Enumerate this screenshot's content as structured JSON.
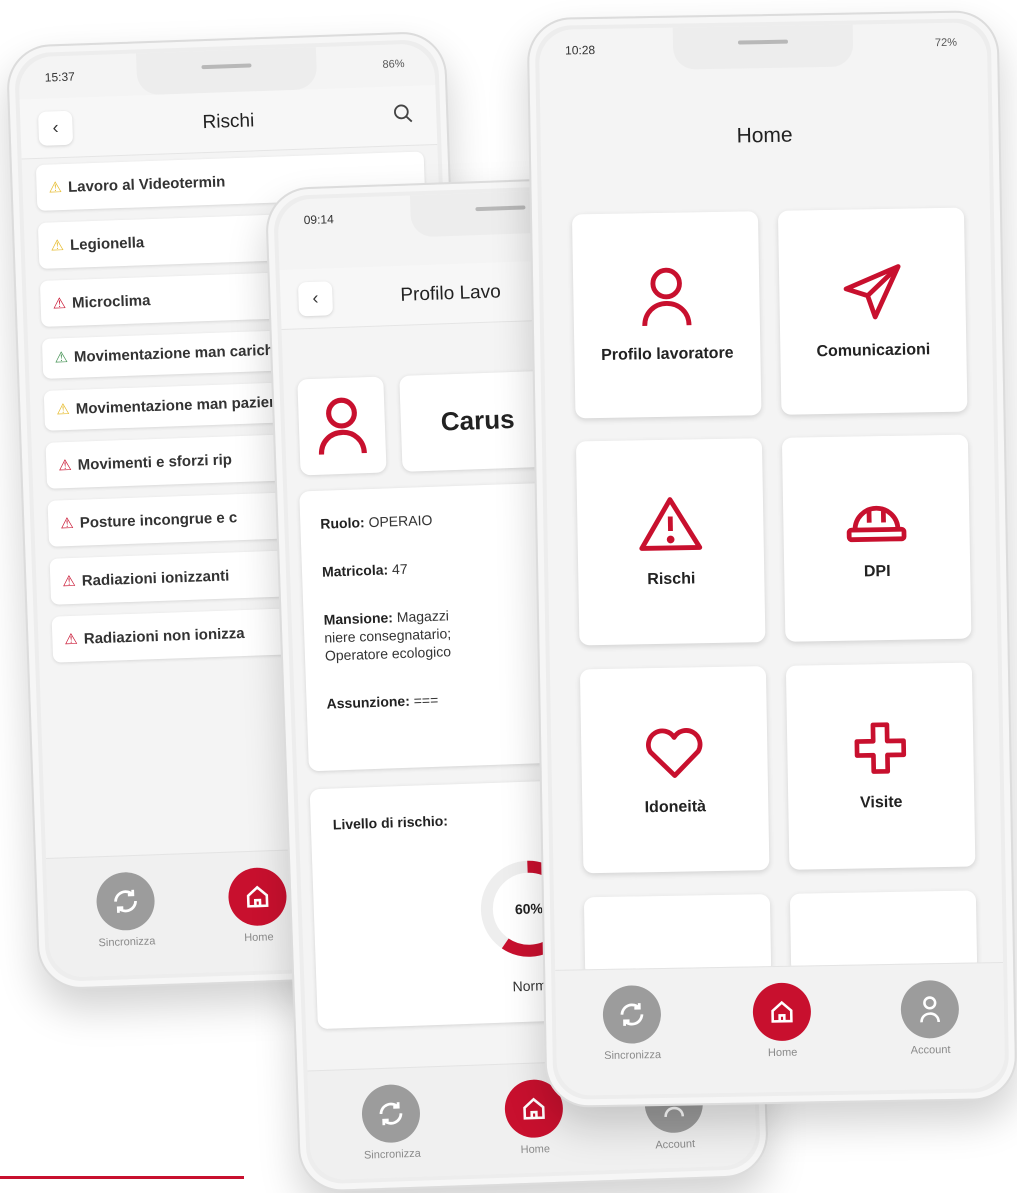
{
  "theme": {
    "accent": "#c8102e",
    "nav_grey": "#9c9c9c",
    "warning_yellow": "#e5b927",
    "ok_green": "#3f8f4f"
  },
  "risks_screen": {
    "status_time": "15:37",
    "status_right": "86%",
    "title": "Rischi",
    "items": [
      {
        "label": "Lavoro al Videotermin",
        "severity": "yellow"
      },
      {
        "label": "Legionella",
        "severity": "yellow"
      },
      {
        "label": "Microclima",
        "severity": "red"
      },
      {
        "label": "Movimentazione man carichi",
        "severity": "green"
      },
      {
        "label": "Movimentazione man pazienti",
        "severity": "yellow"
      },
      {
        "label": "Movimenti e sforzi rip",
        "severity": "red"
      },
      {
        "label": "Posture incongrue e c",
        "severity": "red"
      },
      {
        "label": "Radiazioni ionizzanti",
        "severity": "red"
      },
      {
        "label": "Radiazioni non ionizza",
        "severity": "red"
      }
    ],
    "nav": {
      "sync": "Sincronizza",
      "home": "Home"
    }
  },
  "profile_screen": {
    "status_time": "09:14",
    "title": "Profilo Lavo",
    "name": "Carus",
    "role_label": "Ruolo:",
    "role_value": "OPERAIO",
    "id_label": "Matricola:",
    "id_value": "47",
    "task_label": "Mansione:",
    "task_value": "Magazzi niere consegnatario; Operatore ecologico",
    "hire_label": "Assunzione:",
    "hire_value": "===",
    "risk_level_label": "Livello di rischio:",
    "risk_percent_value": 0.6,
    "risk_percent_text": "60%",
    "risk_status": "Normal",
    "nav": {
      "sync": "Sincronizza",
      "home": "Home",
      "account": "Account"
    }
  },
  "home_screen": {
    "status_time": "10:28",
    "status_right": "72%",
    "title": "Home",
    "tiles": [
      {
        "label": "Profilo lavoratore",
        "icon": "person-icon"
      },
      {
        "label": "Comunicazioni",
        "icon": "send-icon"
      },
      {
        "label": "Rischi",
        "icon": "warning-icon"
      },
      {
        "label": "DPI",
        "icon": "helmet-icon"
      },
      {
        "label": "Idoneità",
        "icon": "heart-icon"
      },
      {
        "label": "Visite",
        "icon": "medical-cross-icon"
      }
    ],
    "nav": {
      "sync": "Sincronizza",
      "home": "Home",
      "account": "Account"
    }
  }
}
